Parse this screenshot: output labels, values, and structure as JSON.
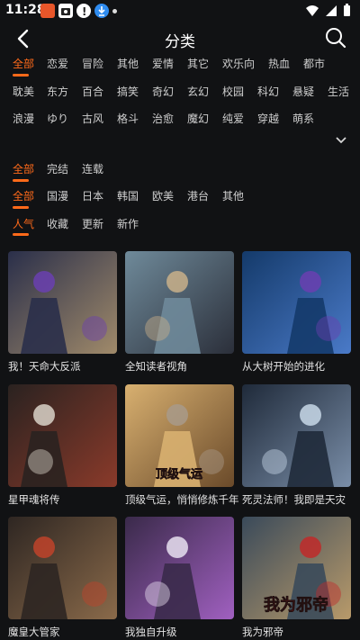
{
  "status": {
    "time": "11:28"
  },
  "header": {
    "title": "分类"
  },
  "genres": [
    {
      "label": "全部",
      "selected": true
    },
    {
      "label": "恋爱"
    },
    {
      "label": "冒险"
    },
    {
      "label": "其他"
    },
    {
      "label": "爱情"
    },
    {
      "label": "其它"
    },
    {
      "label": "欢乐向"
    },
    {
      "label": "热血"
    },
    {
      "label": "都市"
    },
    {
      "label": "耽美"
    },
    {
      "label": "东方"
    },
    {
      "label": "百合"
    },
    {
      "label": "搞笑"
    },
    {
      "label": "奇幻"
    },
    {
      "label": "玄幻"
    },
    {
      "label": "校园"
    },
    {
      "label": "科幻"
    },
    {
      "label": "悬疑"
    },
    {
      "label": "生活"
    },
    {
      "label": "浪漫"
    },
    {
      "label": "ゆり"
    },
    {
      "label": "古风"
    },
    {
      "label": "格斗"
    },
    {
      "label": "治愈"
    },
    {
      "label": "魔幻"
    },
    {
      "label": "纯爱"
    },
    {
      "label": "穿越"
    },
    {
      "label": "萌系"
    }
  ],
  "status_filters": [
    {
      "label": "全部",
      "selected": true
    },
    {
      "label": "完结"
    },
    {
      "label": "连载"
    }
  ],
  "region_filters": [
    {
      "label": "全部",
      "selected": true
    },
    {
      "label": "国漫"
    },
    {
      "label": "日本"
    },
    {
      "label": "韩国"
    },
    {
      "label": "欧美"
    },
    {
      "label": "港台"
    },
    {
      "label": "其他"
    }
  ],
  "sort_filters": [
    {
      "label": "人气",
      "selected": true
    },
    {
      "label": "收藏"
    },
    {
      "label": "更新"
    },
    {
      "label": "新作"
    }
  ],
  "comics": [
    {
      "title": "我！天命大反派",
      "palette": [
        "#2a2f4a",
        "#a08a6a",
        "#6a3fb0"
      ]
    },
    {
      "title": "全知读者视角",
      "palette": [
        "#6f8a9a",
        "#2b2f3a",
        "#c9b08a"
      ]
    },
    {
      "title": "从大树开始的进化",
      "palette": [
        "#143a6a",
        "#4a7ac8",
        "#6a3fb0"
      ]
    },
    {
      "title": "星甲魂将传",
      "palette": [
        "#2a2220",
        "#8a3a2a",
        "#d9d2c8"
      ]
    },
    {
      "title": "顶级气运，悄悄修炼千年",
      "palette": [
        "#d8b070",
        "#6a4a2a",
        "#a89a8a"
      ]
    },
    {
      "title": "死灵法师！我即是天灾",
      "palette": [
        "#1f2a3a",
        "#7a8ea8",
        "#c8d8e8"
      ]
    },
    {
      "title": "魔皇大管家",
      "palette": [
        "#2e2622",
        "#8a6a4a",
        "#c0432a"
      ]
    },
    {
      "title": "我独自升级",
      "palette": [
        "#3a2a4a",
        "#a060c0",
        "#e8e0f0"
      ]
    },
    {
      "title": "我为邪帝",
      "palette": [
        "#3a4a5a",
        "#b89a6a",
        "#c02a2a"
      ]
    }
  ],
  "comic_art_text": {
    "cover_5": "顶级气运",
    "cover_9": "我为邪帝"
  },
  "colors": {
    "accent": "#ff6a1a",
    "background": "#111214",
    "text": "#d6d6d6"
  }
}
